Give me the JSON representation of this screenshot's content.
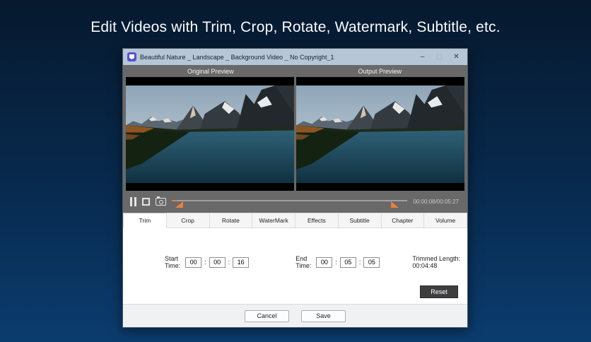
{
  "heading": "Edit Videos with Trim, Crop, Rotate, Watermark, Subtitle, etc.",
  "window": {
    "title": "Beautiful Nature _ Landscape _ Background Video _ No Copyright_1",
    "minimize": "–",
    "maximize": "▢",
    "close": "✕"
  },
  "preview": {
    "original": "Original Preview",
    "output": "Output Preview"
  },
  "playback": {
    "time": "00:00:08/00:05:27",
    "progress_percent": 2.4,
    "trim_start_percent": 1.5,
    "trim_end_percent": 93,
    "icons": {
      "pause": "pause-icon",
      "stop": "stop-icon",
      "snapshot": "camera-icon"
    }
  },
  "tabs": [
    {
      "label": "Trim",
      "active": true
    },
    {
      "label": "Crop"
    },
    {
      "label": "Rotate"
    },
    {
      "label": "WaterMark"
    },
    {
      "label": "Effects"
    },
    {
      "label": "Subtitle"
    },
    {
      "label": "Chapter"
    },
    {
      "label": "Volume"
    }
  ],
  "trim_panel": {
    "start_label": "Start Time:",
    "start_h": "00",
    "start_m": "00",
    "start_s": "16",
    "end_label": "End Time:",
    "end_h": "00",
    "end_m": "05",
    "end_s": "05",
    "time_separator": ":",
    "trimmed_length_label": "Trimmed Length:",
    "trimmed_length_value": "00:04:48",
    "reset": "Reset"
  },
  "footer": {
    "cancel": "Cancel",
    "save": "Save"
  },
  "colors": {
    "accent_orange": "#E8813C",
    "titlebar": "#B7C6D6",
    "preview_gray": "#696969",
    "background_top": "#06192E",
    "background_bottom": "#0B3C6E"
  }
}
